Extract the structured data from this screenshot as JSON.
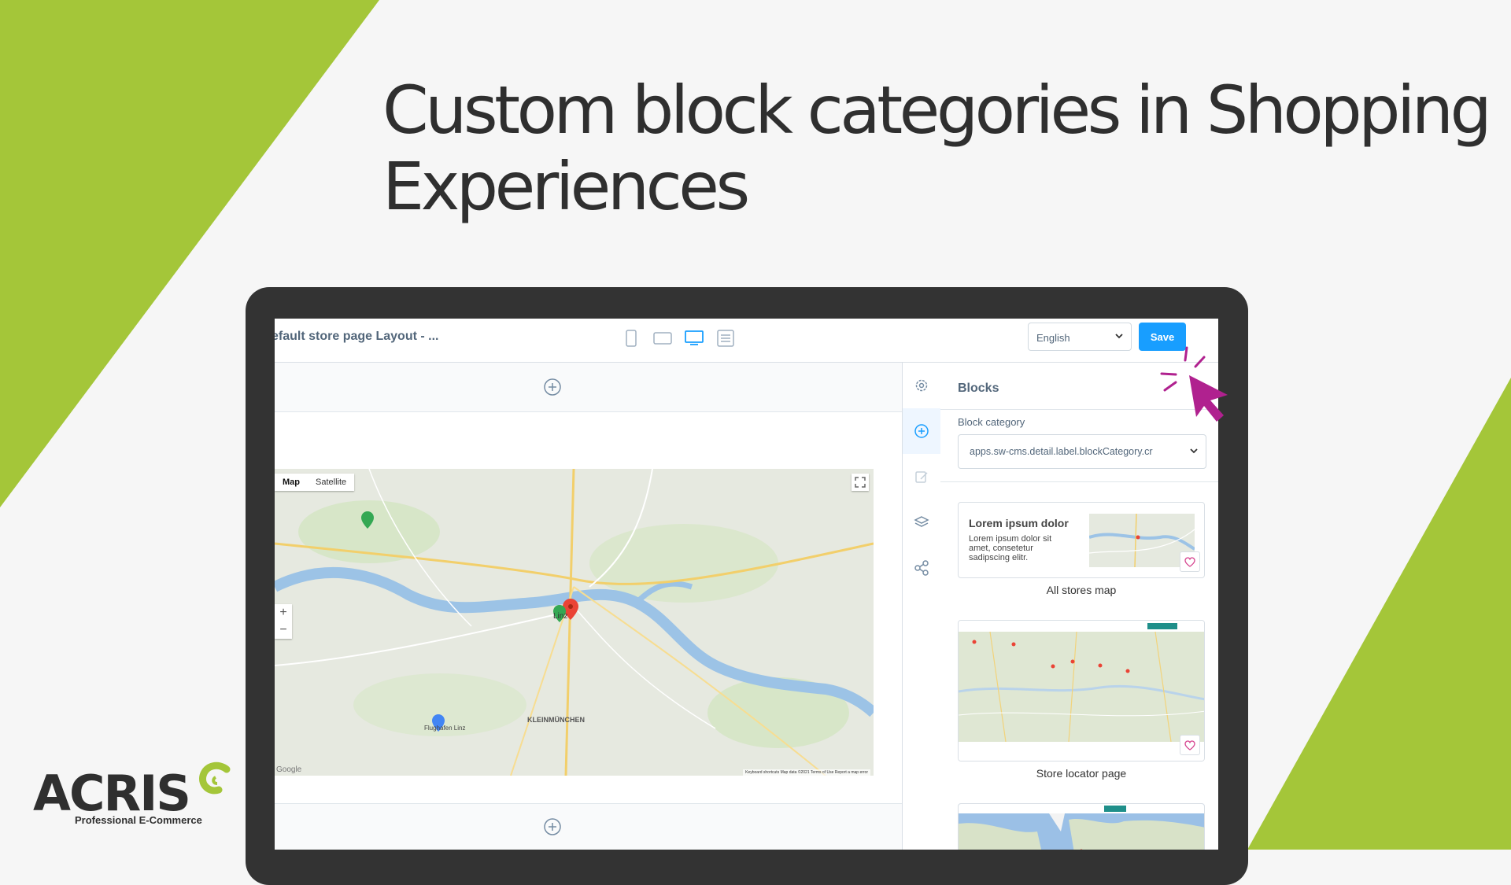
{
  "headline": {
    "line1": "Custom block categories in Shopping",
    "line2": "Experiences"
  },
  "colors": {
    "accent_green": "#a4c639",
    "save_blue": "#189eff",
    "cursor_magenta": "#b0218f",
    "laptop": "#333333"
  },
  "editor": {
    "layout_title": "efault store page Layout - ...",
    "device_icons": [
      "mobile-icon",
      "tablet-icon",
      "desktop-icon",
      "form-icon"
    ],
    "language": "English",
    "save_label": "Save"
  },
  "map": {
    "tab_map": "Map",
    "tab_satellite": "Satellite",
    "zoom_in": "+",
    "zoom_out": "−",
    "attribution": "Keyboard shortcuts   Map data ©2021   Terms of Use   Report a map error",
    "google": "Google",
    "labels": [
      "Linz",
      "KLEINMÜNCHEN",
      "Flughafen Linz"
    ]
  },
  "sidebar_icons": [
    "gear-icon",
    "add-icon",
    "edit-icon",
    "layers-icon",
    "share-icon"
  ],
  "panel": {
    "title": "Blocks",
    "category_label": "Block category",
    "category_value": "apps.sw-cms.detail.label.blockCategory.cr",
    "blocks": [
      {
        "preview_title": "Lorem ipsum dolor",
        "preview_text": "Lorem ipsum dolor sit amet, consetetur sadipscing elitr.",
        "name": "All stores map"
      },
      {
        "name": "Store locator page"
      }
    ]
  },
  "logo": {
    "word": "ACRIS",
    "tagline": "Professional E-Commerce"
  }
}
